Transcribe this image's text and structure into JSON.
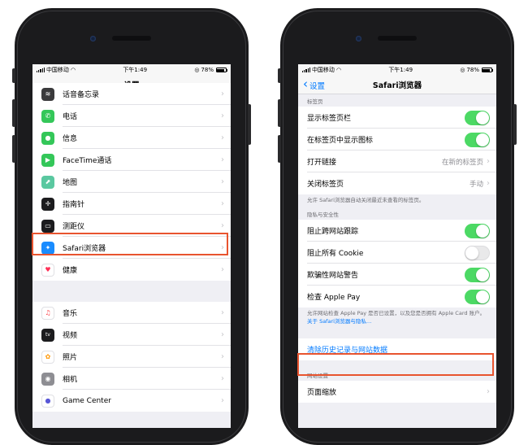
{
  "left": {
    "status": {
      "carrier": "中国移动",
      "time": "下午1:49",
      "battery": "78%",
      "battery_level": 0.78
    },
    "nav_title": "设置",
    "group1": [
      {
        "label": "话音备忘录",
        "icon": "voice-memo-icon",
        "color": "#3a3a3c",
        "glyph": "≋"
      },
      {
        "label": "电话",
        "icon": "phone-icon",
        "color": "#34c759",
        "glyph": "✆"
      },
      {
        "label": "信息",
        "icon": "messages-icon",
        "color": "#34c759",
        "glyph": "●"
      },
      {
        "label": "FaceTime通话",
        "icon": "facetime-icon",
        "color": "#34c759",
        "glyph": "▶"
      },
      {
        "label": "地图",
        "icon": "maps-icon",
        "color": "#5ac8a0",
        "glyph": "⬈"
      },
      {
        "label": "指南针",
        "icon": "compass-icon",
        "color": "#1c1c1e",
        "glyph": "✛"
      },
      {
        "label": "测距仪",
        "icon": "measure-icon",
        "color": "#1c1c1e",
        "glyph": "▭"
      },
      {
        "label": "Safari浏览器",
        "icon": "safari-icon",
        "color": "#1a8cff",
        "glyph": "✦"
      },
      {
        "label": "健康",
        "icon": "health-icon",
        "color": "#ffffff",
        "glyph": "♥"
      }
    ],
    "group2": [
      {
        "label": "音乐",
        "icon": "music-icon",
        "color": "#ffffff",
        "glyph": "♫"
      },
      {
        "label": "视频",
        "icon": "tv-icon",
        "color": "#1c1c1e",
        "glyph": "tv"
      },
      {
        "label": "照片",
        "icon": "photos-icon",
        "color": "#ffffff",
        "glyph": "✿"
      },
      {
        "label": "相机",
        "icon": "camera-icon",
        "color": "#8e8e93",
        "glyph": "◉"
      },
      {
        "label": "Game Center",
        "icon": "game-center-icon",
        "color": "#ffffff",
        "glyph": "●"
      }
    ]
  },
  "right": {
    "status": {
      "carrier": "中国移动",
      "time": "下午1:49",
      "battery": "78%",
      "battery_level": 0.78
    },
    "back_label": "设置",
    "nav_title": "Safari浏览器",
    "tabs_header": "标签页",
    "tabs_rows": [
      {
        "label": "显示标签页栏",
        "type": "toggle",
        "on": true
      },
      {
        "label": "在标签页中显示图标",
        "type": "toggle",
        "on": true
      },
      {
        "label": "打开链接",
        "type": "value",
        "value": "在新的标签页"
      },
      {
        "label": "关闭标签页",
        "type": "value",
        "value": "手动"
      }
    ],
    "tabs_footer": "允许 Safari浏览器自动关闭最近未查看的标签页。",
    "privacy_header": "隐私与安全性",
    "privacy_rows": [
      {
        "label": "阻止跨网站跟踪",
        "type": "toggle",
        "on": true
      },
      {
        "label": "阻止所有 Cookie",
        "type": "toggle",
        "on": false
      },
      {
        "label": "欺骗性网站警告",
        "type": "toggle",
        "on": true
      },
      {
        "label": "检查 Apple Pay",
        "type": "toggle",
        "on": true
      }
    ],
    "privacy_footer": "允许网站检查 Apple Pay 是否已设置，以及您是否拥有 Apple Card 账户。",
    "privacy_link": "关于 Safari浏览器与隐私…",
    "clear_label": "清除历史记录与网站数据",
    "website_header": "网站设置",
    "website_rows": [
      {
        "label": "页面缩放"
      }
    ]
  },
  "colors": {
    "accent": "#007aff",
    "toggle_on": "#4cd964",
    "highlight": "#e8542f"
  }
}
